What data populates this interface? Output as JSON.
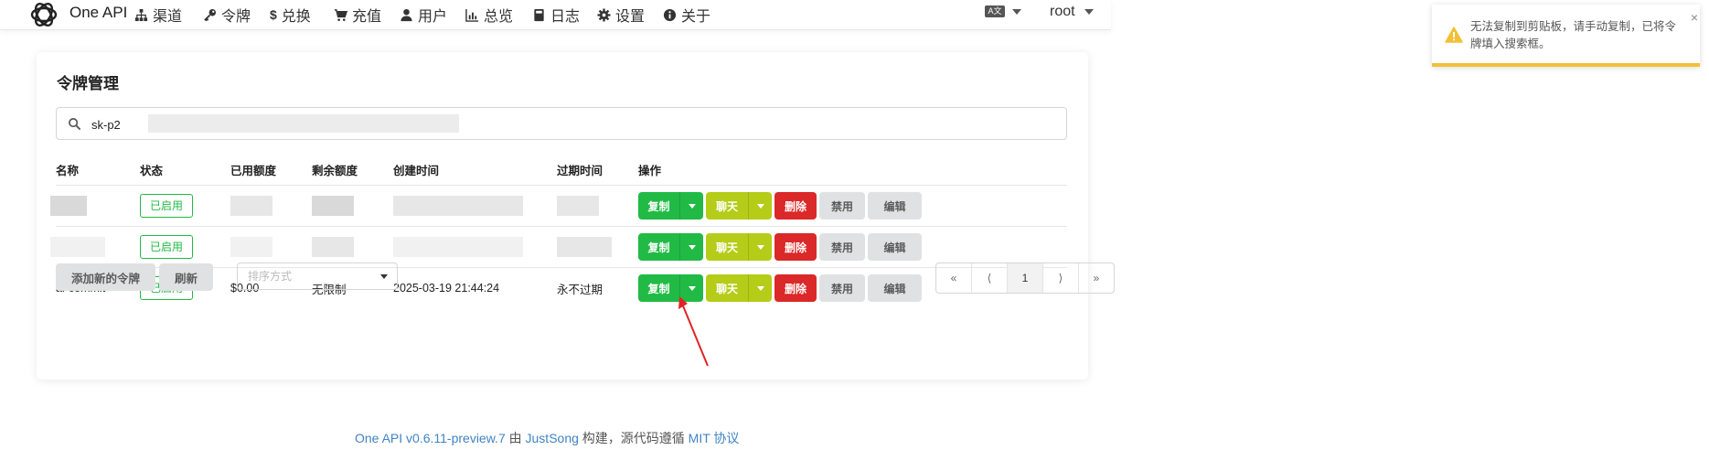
{
  "nav": {
    "brand": "One API",
    "items": [
      {
        "label": "渠道",
        "icon": "sitemap-icon"
      },
      {
        "label": "令牌",
        "icon": "key-icon"
      },
      {
        "label": "兑换",
        "icon": "dollar-icon"
      },
      {
        "label": "充值",
        "icon": "cart-icon"
      },
      {
        "label": "用户",
        "icon": "user-icon"
      },
      {
        "label": "总览",
        "icon": "bar-chart-icon"
      },
      {
        "label": "日志",
        "icon": "book-icon"
      },
      {
        "label": "设置",
        "icon": "gear-icon"
      },
      {
        "label": "关于",
        "icon": "info-icon"
      }
    ],
    "language_icon": "translate-icon",
    "user": "root"
  },
  "card": {
    "title": "令牌管理",
    "search_value": "sk-p2",
    "columns": [
      "名称",
      "状态",
      "已用额度",
      "剩余额度",
      "创建时间",
      "过期时间",
      "操作"
    ],
    "rows": [
      {
        "name": "",
        "status": "已启用",
        "used": "",
        "remaining": "",
        "created": "",
        "expires": "",
        "redacted": true
      },
      {
        "name": "",
        "status": "已启用",
        "used": "",
        "remaining": "",
        "created": "",
        "expires": "",
        "redacted": true
      },
      {
        "name": "ai-commit",
        "status": "已启用",
        "used": "$0.00",
        "remaining": "无限制",
        "created": "2025-03-19 21:44:24",
        "expires": "永不过期",
        "redacted": false
      }
    ],
    "actions": {
      "copy": "复制",
      "chat": "聊天",
      "delete": "删除",
      "disable": "禁用",
      "edit": "编辑"
    },
    "add_button": "添加新的令牌",
    "refresh_button": "刷新",
    "sort_placeholder": "排序方式",
    "pagination": [
      "«",
      "⟨",
      "1",
      "⟩",
      "»"
    ],
    "current_page": "1"
  },
  "footer": {
    "version_link": "One API v0.6.11-preview.7",
    "by": " 由 ",
    "author_link": "JustSong",
    "built": " 构建，源代码遵循 ",
    "license_link": "MIT 协议"
  },
  "toast": {
    "message": "无法复制到剪贴板，请手动复制，已将令牌填入搜索框。",
    "close": "×",
    "icon": "warning-icon"
  },
  "colors": {
    "green": "#21ba45",
    "olive": "#b5cc18",
    "red": "#db2828",
    "grey": "#e0e1e2",
    "link": "#4183c4",
    "warning": "#f2c037",
    "annotation_arrow": "#e02424"
  }
}
